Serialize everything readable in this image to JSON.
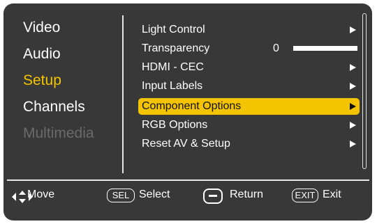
{
  "left_menu": {
    "items": [
      {
        "label": "Video",
        "state": "normal"
      },
      {
        "label": "Audio",
        "state": "normal"
      },
      {
        "label": "Setup",
        "state": "active"
      },
      {
        "label": "Channels",
        "state": "normal"
      },
      {
        "label": "Multimedia",
        "state": "disabled"
      }
    ]
  },
  "submenu": {
    "items": [
      {
        "label": "Light Control",
        "type": "submenu"
      },
      {
        "label": "Transparency",
        "type": "slider",
        "value": "0"
      },
      {
        "label": "HDMI - CEC",
        "type": "submenu"
      },
      {
        "label": "Input Labels",
        "type": "submenu"
      },
      {
        "label": "Component Options",
        "type": "submenu",
        "selected": true
      },
      {
        "label": "RGB Options",
        "type": "submenu"
      },
      {
        "label": "Reset AV & Setup",
        "type": "submenu"
      }
    ]
  },
  "footer": {
    "move_label": "Move",
    "sel_key": "SEL",
    "select_label": "Select",
    "return_label": "Return",
    "exit_key": "EXIT",
    "exit_label": "Exit"
  },
  "colors": {
    "background": "#383838",
    "accent": "#f5c400",
    "text": "#ffffff",
    "disabled": "#6a6a6a"
  }
}
